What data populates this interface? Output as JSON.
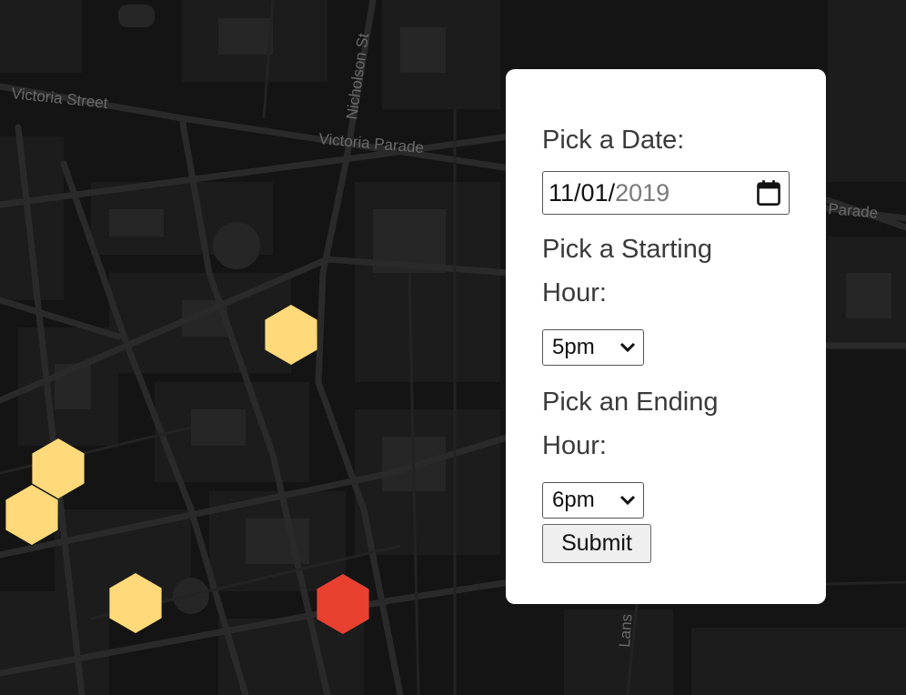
{
  "map": {
    "street_labels": [
      "Victoria Street",
      "Victoria Parade",
      "Nicholson St",
      "Parade",
      "Lans"
    ],
    "hex_colors": {
      "low": "#ffd97a",
      "high": "#e8412f"
    },
    "hexagons": [
      {
        "level": "low"
      },
      {
        "level": "low"
      },
      {
        "level": "low"
      },
      {
        "level": "low"
      },
      {
        "level": "high"
      }
    ]
  },
  "form": {
    "date_label": "Pick a Date:",
    "date": {
      "month": "11",
      "day": "01",
      "year": "2019",
      "sep": "/"
    },
    "start_label": "Pick a Starting Hour:",
    "start_value": "5pm",
    "end_label": "Pick an Ending Hour:",
    "end_value": "6pm",
    "submit_label": "Submit"
  }
}
